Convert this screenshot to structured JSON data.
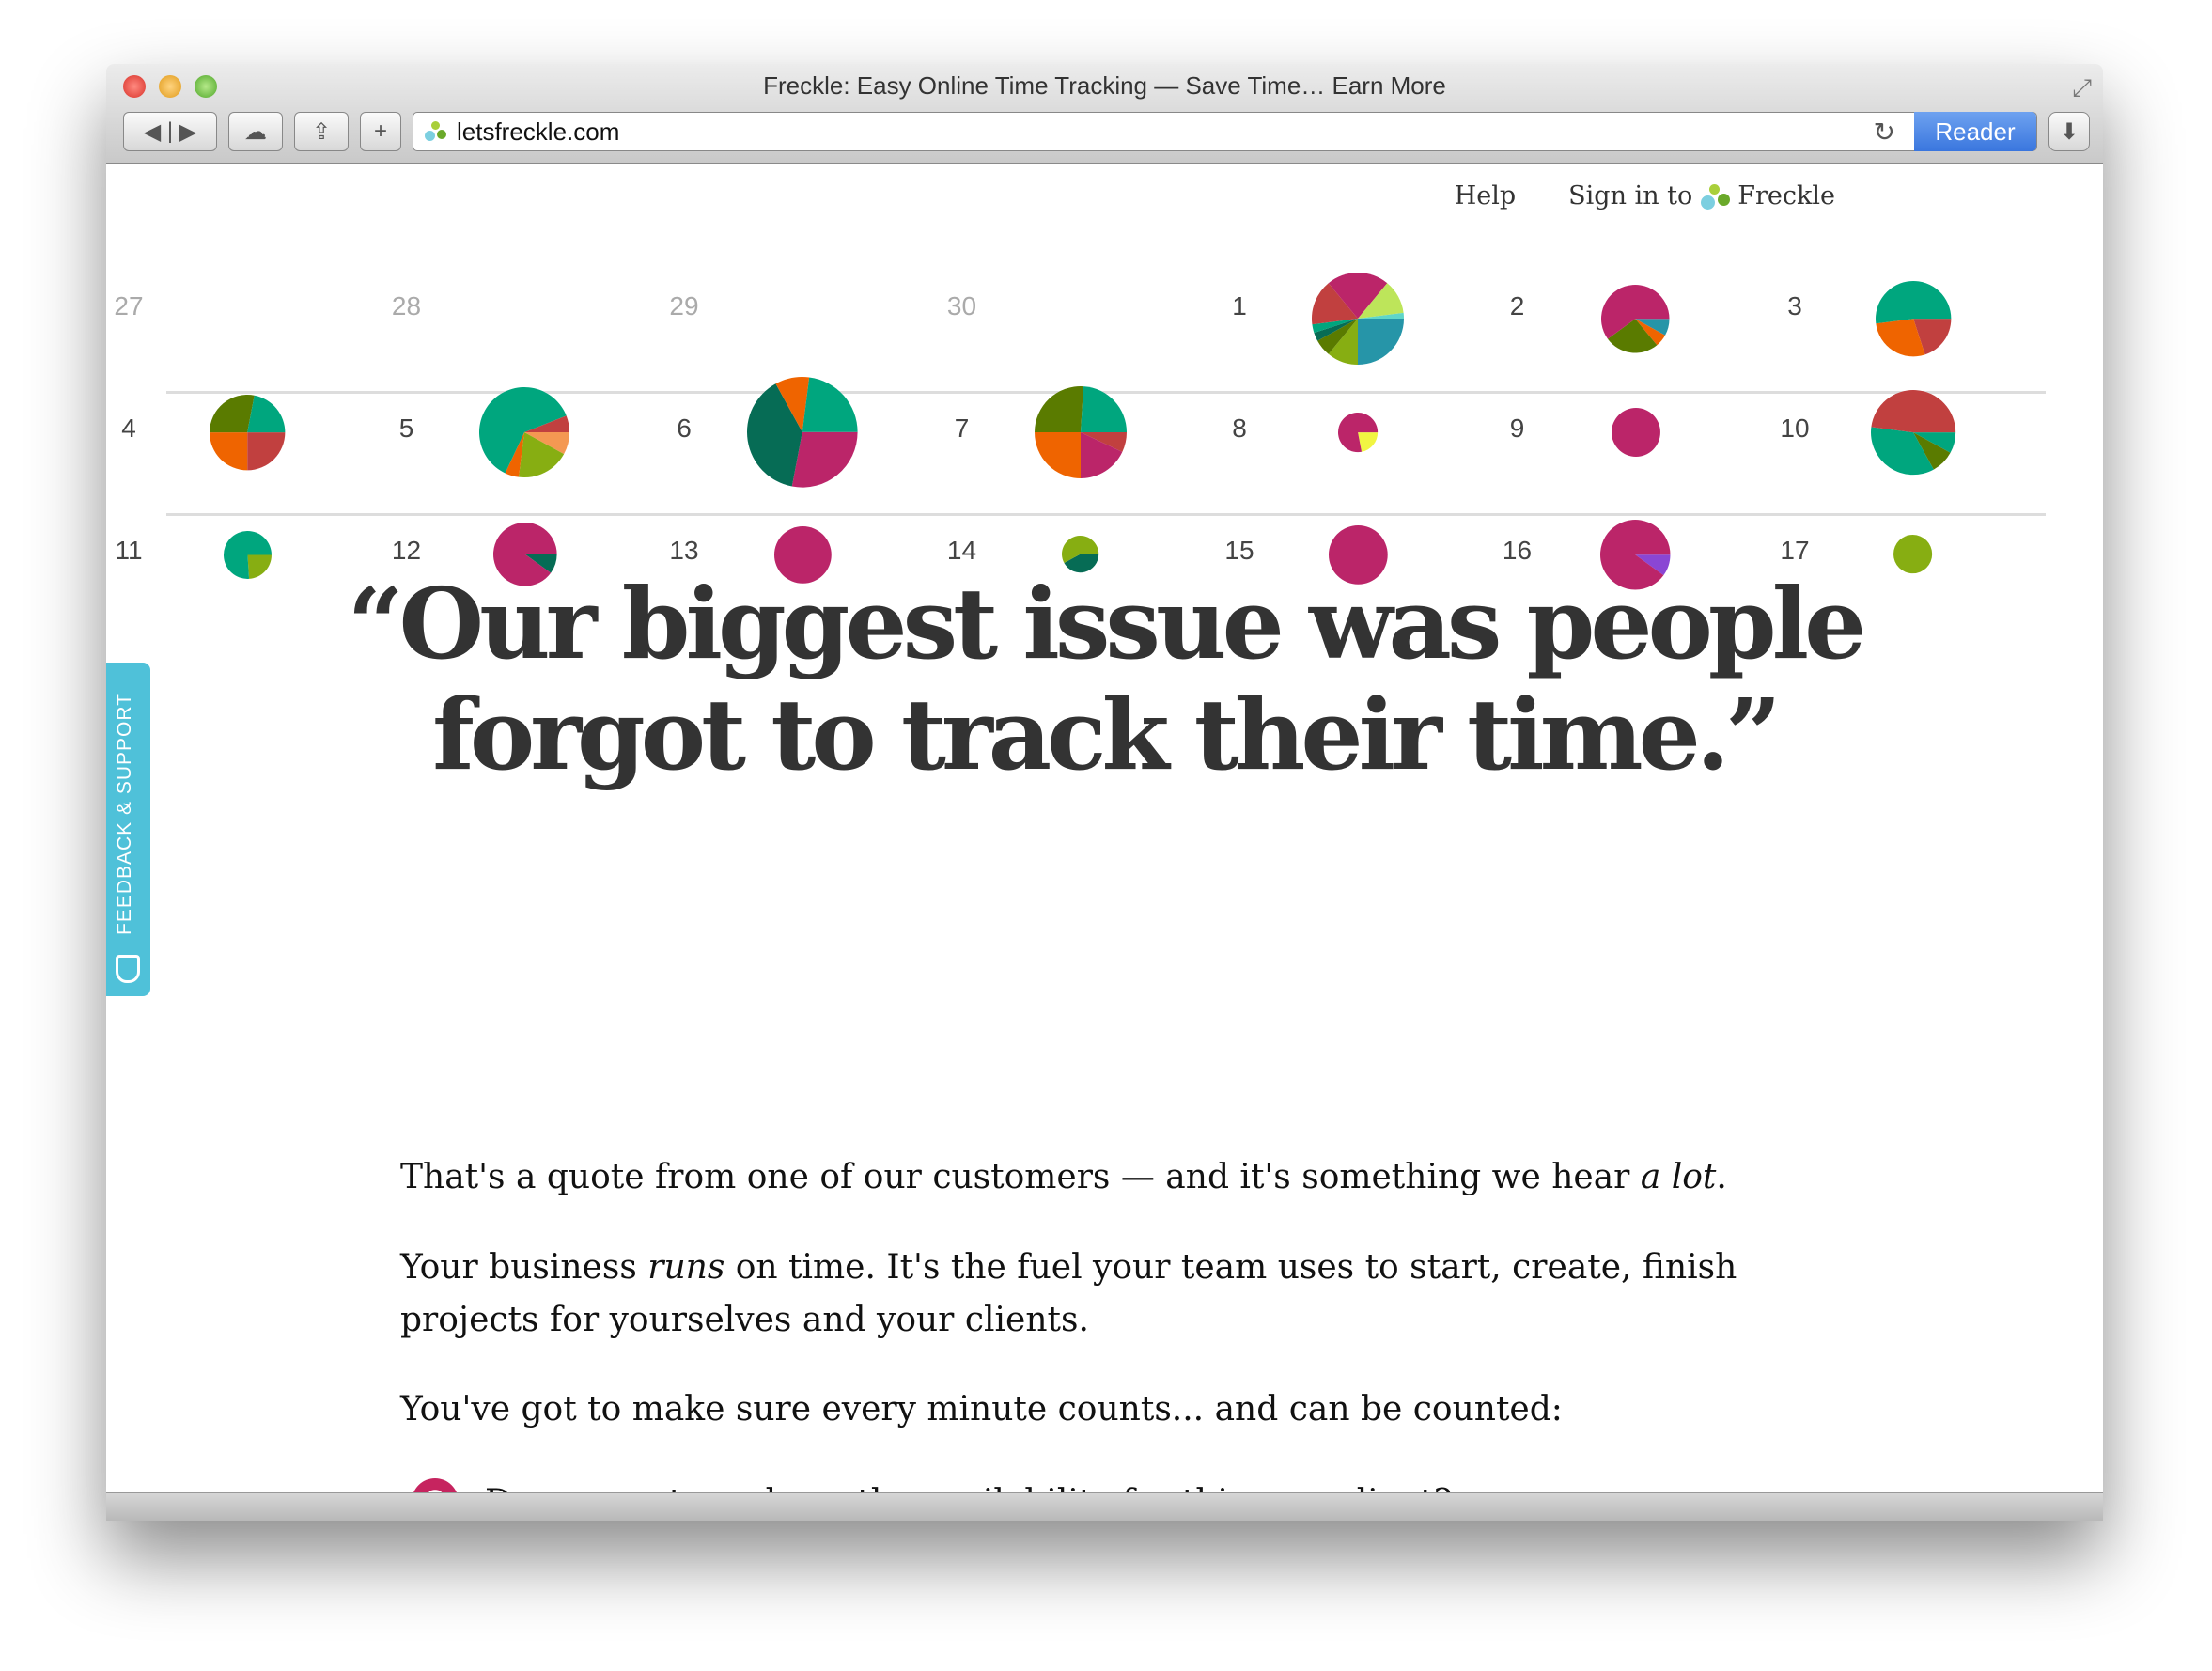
{
  "window": {
    "title": "Freckle: Easy Online Time Tracking — Save Time… Earn More",
    "url": "letsfreckle.com",
    "reader_label": "Reader"
  },
  "nav": {
    "help": "Help",
    "sign_in": "Sign in to",
    "brand": "Freckle"
  },
  "colors": {
    "magenta": "#bb2569",
    "teal": "#00a67e",
    "red": "#c1403f",
    "orange": "#ef6400",
    "olive": "#5a7b00",
    "lime": "#87ae12",
    "darkgreen": "#066c55",
    "blue": "#2695a8",
    "lightlime": "#bde55a",
    "yellow": "#f1f542",
    "peach": "#f49852",
    "purple": "#8a46d4",
    "feedback": "#4fc1d9"
  },
  "calendar": {
    "weeks": [
      [
        {
          "d": "27",
          "muted": true
        },
        {
          "d": "28",
          "muted": true
        },
        {
          "d": "29",
          "muted": true
        },
        {
          "d": "30",
          "muted": true
        },
        {
          "d": "1",
          "size": 1.0,
          "slices": [
            [
              "blue",
              25
            ],
            [
              "lime",
              11
            ],
            [
              "olive",
              6
            ],
            [
              "darkgreen",
              3
            ],
            [
              "teal",
              3
            ],
            [
              "red",
              16
            ],
            [
              "magenta",
              22
            ],
            [
              "lightlime",
              12
            ],
            [
              "#5fd6c8",
              2
            ]
          ]
        },
        {
          "d": "2",
          "size": 0.74,
          "slices": [
            [
              "blue",
              8
            ],
            [
              "orange",
              6
            ],
            [
              "olive",
              26
            ],
            [
              "magenta",
              60
            ]
          ]
        },
        {
          "d": "3",
          "size": 0.82,
          "slices": [
            [
              "red",
              20
            ],
            [
              "orange",
              28
            ],
            [
              "teal",
              52
            ]
          ]
        }
      ],
      [
        {
          "d": "4",
          "size": 0.82,
          "slices": [
            [
              "red",
              25
            ],
            [
              "orange",
              25
            ],
            [
              "olive",
              28
            ],
            [
              "teal",
              22
            ]
          ]
        },
        {
          "d": "5",
          "size": 0.98,
          "slices": [
            [
              "peach",
              8
            ],
            [
              "lime",
              19
            ],
            [
              "orange",
              5
            ],
            [
              "teal",
              62
            ],
            [
              "red",
              6
            ]
          ]
        },
        {
          "d": "6",
          "size": 1.2,
          "slices": [
            [
              "magenta",
              28
            ],
            [
              "darkgreen",
              39
            ],
            [
              "orange",
              10
            ],
            [
              "teal",
              23
            ]
          ]
        },
        {
          "d": "7",
          "size": 1.0,
          "slices": [
            [
              "red",
              7
            ],
            [
              "magenta",
              18
            ],
            [
              "orange",
              25
            ],
            [
              "olive",
              26
            ],
            [
              "teal",
              24
            ]
          ]
        },
        {
          "d": "8",
          "size": 0.43,
          "slices": [
            [
              "yellow",
              22
            ],
            [
              "magenta",
              78
            ]
          ]
        },
        {
          "d": "9",
          "size": 0.53,
          "slices": [
            [
              "magenta",
              100
            ]
          ]
        },
        {
          "d": "10",
          "size": 0.92,
          "slices": [
            [
              "teal",
              8
            ],
            [
              "olive",
              9
            ],
            [
              "teal",
              35
            ],
            [
              "red",
              48
            ]
          ]
        }
      ],
      [
        {
          "d": "11",
          "size": 0.52,
          "slices": [
            [
              "lime",
              24
            ],
            [
              "teal",
              76
            ]
          ]
        },
        {
          "d": "12",
          "size": 0.69,
          "slices": [
            [
              "darkgreen",
              10
            ],
            [
              "magenta",
              90
            ]
          ]
        },
        {
          "d": "13",
          "size": 0.62,
          "slices": [
            [
              "magenta",
              100
            ]
          ]
        },
        {
          "d": "14",
          "size": 0.4,
          "slices": [
            [
              "darkgreen",
              42
            ],
            [
              "lime",
              58
            ]
          ]
        },
        {
          "d": "15",
          "size": 0.64,
          "slices": [
            [
              "magenta",
              100
            ]
          ]
        },
        {
          "d": "16",
          "size": 0.76,
          "slices": [
            [
              "purple",
              10
            ],
            [
              "magenta",
              90
            ]
          ]
        },
        {
          "d": "17",
          "size": 0.42,
          "slices": [
            [
              "lime",
              100
            ]
          ]
        }
      ]
    ]
  },
  "headline": {
    "line1": "“Our biggest issue was people",
    "line2": "forgot to track their time.”"
  },
  "body": {
    "p1a": "That's a quote from one of our customers — and it's something we hear ",
    "p1b": "a lot",
    ".": ".",
    "p2a": "Your business ",
    "p2b": "runs",
    "p2c": " on time. It's the fuel your team uses to start, create, finish projects for yourselves and your clients.",
    "p3": "You've got to make sure every minute counts... and can be counted:",
    "q1": "Does your team have the availability for this new client?"
  },
  "feedback": {
    "label": "FEEDBACK & SUPPORT"
  }
}
